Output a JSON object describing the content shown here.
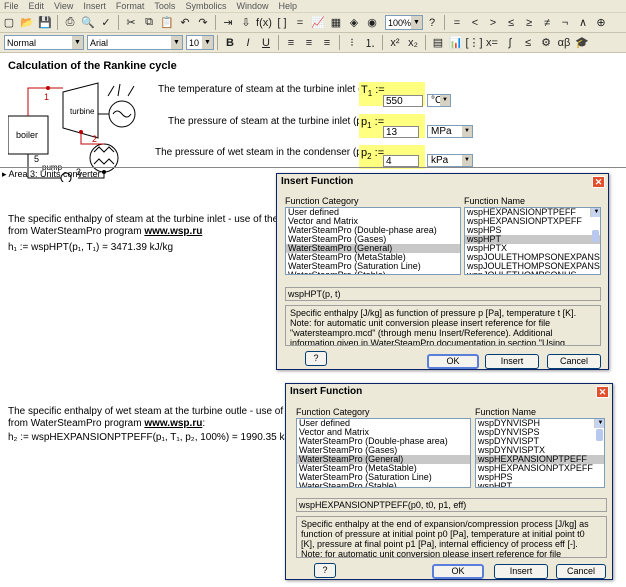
{
  "menu": [
    "File",
    "Edit",
    "View",
    "Insert",
    "Format",
    "Tools",
    "Symbolics",
    "Window",
    "Help"
  ],
  "toolbar": {
    "zoom": "100%",
    "style": "Normal",
    "font": "Arial",
    "size": "10",
    "bold": "B",
    "italic": "I",
    "underline": "U",
    "math_symbols": [
      "=",
      "<",
      ">",
      "≤",
      "≥",
      "≠",
      "¬",
      "∧",
      "⊕"
    ]
  },
  "document": {
    "title": "Calculation of the Rankine cycle",
    "diagram": {
      "turbine": "turbine",
      "boiler": "boiler",
      "pump": "pump",
      "points": [
        "1",
        "2",
        "3",
        "5"
      ]
    },
    "inputs": [
      {
        "question": "The temperature of steam at the turbine inlet (point 1)",
        "var": "T",
        "sub": "1",
        "value": "550",
        "unit": "°C"
      },
      {
        "question": "The pressure of steam at the turbine inlet (point 1)",
        "var": "p",
        "sub": "1",
        "value": "13",
        "unit": "MPa"
      },
      {
        "question": "The pressure of wet steam in the condenser (point 2)",
        "var": "p",
        "sub": "2",
        "value": "4",
        "unit": "kPa"
      }
    ],
    "area_label": "Area 3: Units converter",
    "para1_line1": "The specific enthalpy of steam at the turbine inlet - use of the functions",
    "para1_line2": "from WaterSteamPro program ",
    "para1_link": "www.wsp.ru",
    "formula1": "h₁ := wspHPT(p₁, T₁) = 3471.39 kJ/kg",
    "para2_line1": "The specific enthalpy of wet steam at the turbine outle - use of the functions",
    "para2_line2": "from WaterSteamPro program ",
    "para2_link": "www.wsp.ru",
    "para2_end": ":",
    "formula2": "h₂ := wspHEXPANSIONPTPEFF(p₁, T₁, p₂, 100%) = 1990.35 kJ/kg"
  },
  "dialog1": {
    "title": "Insert Function",
    "cat_label": "Function Category",
    "name_label": "Function Name",
    "categories": [
      "User defined",
      "Vector and Matrix",
      "WaterSteamPro (Double-phase area)",
      "WaterSteamPro (Gases)",
      "WaterSteamPro (General)",
      "WaterSteamPro (MetaStable)",
      "WaterSteamPro (Saturation Line)",
      "WaterSteamPro (Stable)"
    ],
    "cat_selected": 4,
    "names": [
      "wspHEXPANSIONPTPEFF",
      "wspHEXPANSIONPTXPEFF",
      "wspHPS",
      "wspHPT",
      "wspHPTX",
      "wspJOULETHOMPSONEXPANSIONP",
      "wspJOULETHOMPSONEXPANSIONP",
      "wspJOULETHOMPSONHS"
    ],
    "name_selected": 3,
    "signature": "wspHPT(p, t)",
    "description": "Specific enthalpy [J/kg] as function of pressure p [Pa], temperature t [K]. Note: for automatic unit conversion please insert reference for file \"watersteampro.mcd\" (through menu Insert/Reference). Additional information given in WaterSteamPro documentation in section \"Using WaterSteamPro in Mathcad\".",
    "help": "?",
    "ok": "OK",
    "insert": "Insert",
    "cancel": "Cancel"
  },
  "dialog2": {
    "title": "Insert Function",
    "cat_label": "Function Category",
    "name_label": "Function Name",
    "categories": [
      "User defined",
      "Vector and Matrix",
      "WaterSteamPro (Double-phase area)",
      "WaterSteamPro (Gases)",
      "WaterSteamPro (General)",
      "WaterSteamPro (MetaStable)",
      "WaterSteamPro (Saturation Line)",
      "WaterSteamPro (Stable)"
    ],
    "cat_selected": 4,
    "names": [
      "wspDYNVISPH",
      "wspDYNVISPS",
      "wspDYNVISPT",
      "wspDYNVISPTX",
      "wspHEXPANSIONPTPEFF",
      "wspHEXPANSIONPTXPEFF",
      "wspHPS",
      "wspHPT",
      "wspHPTX"
    ],
    "name_selected": 4,
    "signature": "wspHEXPANSIONPTPEFF(p0, t0, p1, eff)",
    "description": "Specific enthalpy at the end of expansion/compression process [J/kg] as function of pressure at initial point p0 [Pa], temperature at initial point t0 [K], pressure at final point p1 [Pa], internal efficiency of process eff [-]. Note: for automatic unit conversion please insert reference for file \"watersteampro.mcd\" (through menu",
    "help": "?",
    "ok": "OK",
    "insert": "Insert",
    "cancel": "Cancel"
  }
}
